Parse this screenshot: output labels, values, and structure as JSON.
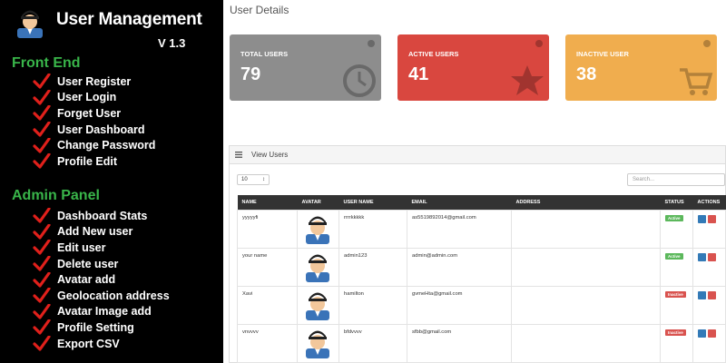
{
  "promo": {
    "title": "User Management",
    "version": "V 1.3",
    "sections": [
      {
        "title": "Front End",
        "items": [
          "User Register",
          "User Login",
          "Forget User",
          "User Dashboard",
          "Change Password",
          "Profile Edit"
        ]
      },
      {
        "title": "Admin Panel",
        "items": [
          "Dashboard Stats",
          "Add New user",
          "Edit user",
          "Delete user",
          "Avatar add",
          "Geolocation address",
          "Avatar Image add",
          "Profile Setting",
          "Export CSV"
        ]
      }
    ]
  },
  "main": {
    "title": "User Details",
    "stats": [
      {
        "label": "TOTAL USERS",
        "value": "79",
        "color": "#8d8d8d",
        "icon": "clock-icon"
      },
      {
        "label": "ACTIVE USERS",
        "value": "41",
        "color": "#d9473f",
        "icon": "star-icon"
      },
      {
        "label": "INACTIVE USER",
        "value": "38",
        "color": "#f0ad4e",
        "icon": "cart-icon"
      }
    ],
    "panel": {
      "title": "View Users",
      "page_length": "10",
      "search_placeholder": "Search..."
    },
    "table": {
      "columns": [
        "NAME",
        "AVATAR",
        "USER NAME",
        "EMAIL",
        "ADDRESS",
        "STATUS",
        "ACTIONS"
      ],
      "rows": [
        {
          "name": "yyyyyfi",
          "username": "rrrrkkkkk",
          "email": "as5519892014@gmail.com",
          "address": "",
          "status": "Active"
        },
        {
          "name": "your name",
          "username": "admin123",
          "email": "admin@admin.com",
          "address": "",
          "status": "Active"
        },
        {
          "name": "Xavi",
          "username": "hamilton",
          "email": "gvmeHta@gmail.com",
          "address": "",
          "status": "Inactive"
        },
        {
          "name": "vnvvvv",
          "username": "bfdvvvv",
          "email": "sfbb@gmail.com",
          "address": "",
          "status": "Inactive"
        }
      ]
    },
    "colors": {
      "active": "#5cb85c",
      "inactive": "#d9534f",
      "edit": "#337ab7",
      "delete": "#d9534f",
      "check": "#e0201b",
      "section": "#39b54a"
    }
  }
}
